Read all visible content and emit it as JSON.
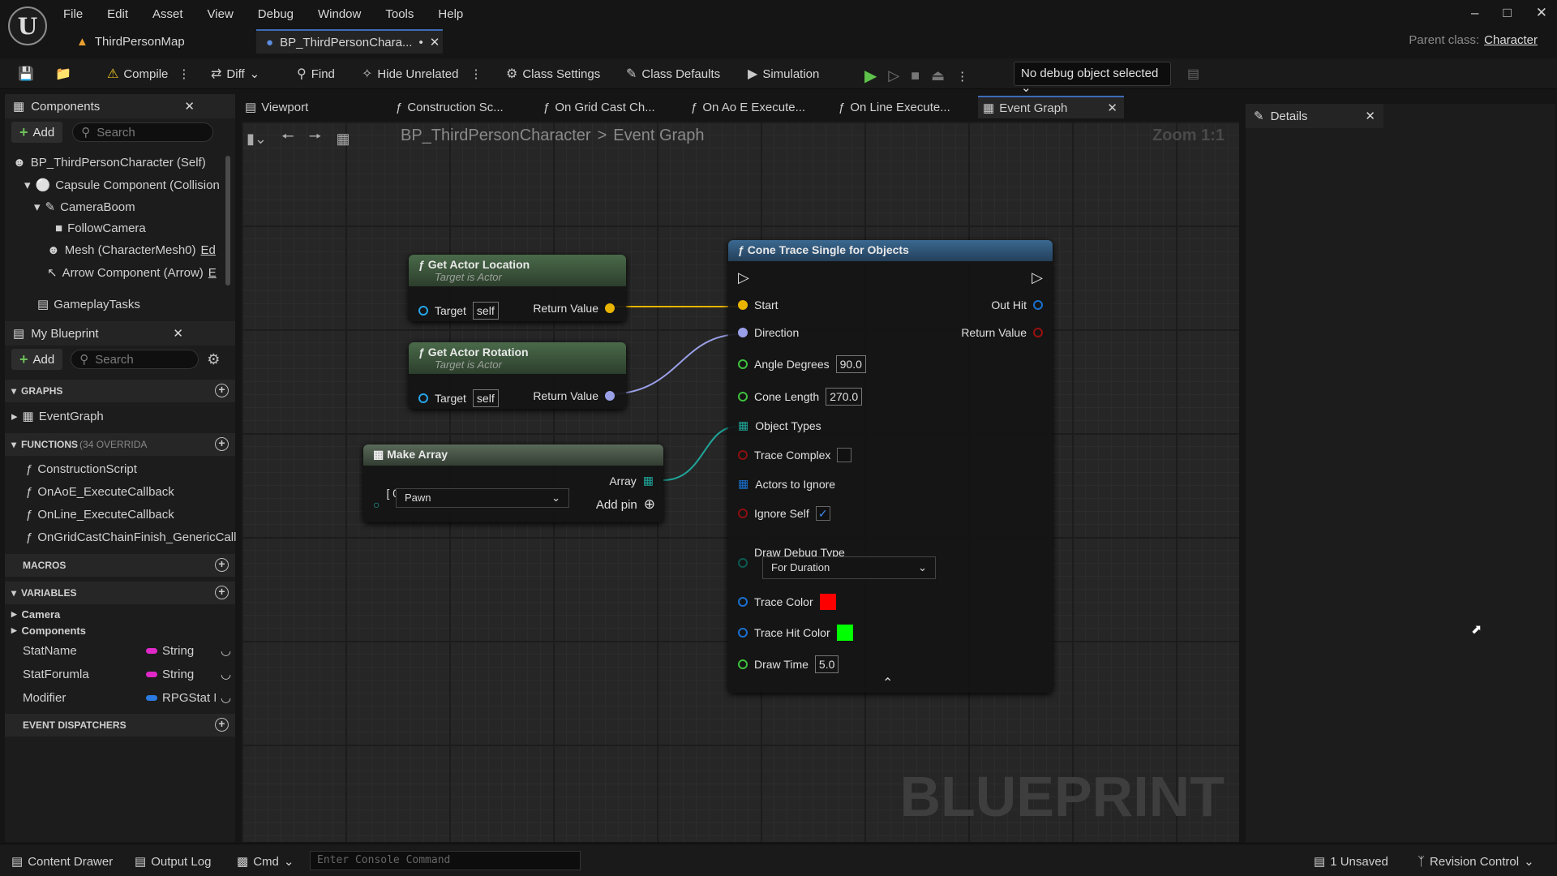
{
  "app": {
    "logo": "U"
  },
  "menu": [
    "File",
    "Edit",
    "Asset",
    "View",
    "Debug",
    "Window",
    "Tools",
    "Help"
  ],
  "window_controls": [
    "minimize-icon",
    "maximize-icon",
    "close-icon"
  ],
  "tabs": [
    {
      "label": "ThirdPersonMap",
      "icon": "map-icon"
    },
    {
      "label": "BP_ThirdPersonChara...",
      "icon": "blueprint-icon",
      "modified": "•"
    }
  ],
  "parent_class": {
    "label": "Parent class:",
    "value": "Character"
  },
  "toolbar": {
    "compile": "Compile",
    "diff": "Diff",
    "find": "Find",
    "hide_unrelated": "Hide Unrelated",
    "class_settings": "Class Settings",
    "class_defaults": "Class Defaults",
    "simulation": "Simulation",
    "debug_object": "No debug object selected"
  },
  "components_panel": {
    "title": "Components",
    "add": "Add",
    "search_placeholder": "Search",
    "items": [
      {
        "label": "BP_ThirdPersonCharacter (Self)"
      },
      {
        "label": "Capsule Component (Collision"
      },
      {
        "label": "CameraBoom"
      },
      {
        "label": "FollowCamera"
      },
      {
        "label": "Mesh (CharacterMesh0)",
        "extra": "Ed"
      },
      {
        "label": "Arrow Component (Arrow)",
        "extra": "E"
      },
      {
        "label": "GameplayTasks"
      }
    ]
  },
  "my_blueprint": {
    "title": "My Blueprint",
    "add": "Add",
    "search_placeholder": "Search",
    "graphs_header": "GRAPHS",
    "graphs": [
      "EventGraph"
    ],
    "functions_header": "FUNCTIONS",
    "functions_override": "(34 OVERRIDA",
    "functions": [
      "ConstructionScript",
      "OnAoE_ExecuteCallback",
      "OnLine_ExecuteCallback",
      "OnGridCastChainFinish_GenericCall"
    ],
    "macros_header": "MACROS",
    "variables_header": "VARIABLES",
    "var_categories": [
      "Camera",
      "Components"
    ],
    "variables": [
      {
        "name": "StatName",
        "type": "String",
        "color": "#e028c8"
      },
      {
        "name": "StatForumla",
        "type": "String",
        "color": "#e028c8"
      },
      {
        "name": "Modifier",
        "type": "RPGStat N",
        "color": "#2a7ae0"
      }
    ],
    "dispatchers_header": "EVENT DISPATCHERS"
  },
  "graph_tabs": [
    "Viewport",
    "Construction Sc...",
    "On Grid Cast Ch...",
    "On Ao E Execute...",
    "On Line Execute...",
    "Event Graph"
  ],
  "breadcrumb": {
    "root": "BP_ThirdPersonCharacter",
    "separator": ">",
    "current": "Event Graph"
  },
  "zoom": "Zoom 1:1",
  "watermark": "BLUEPRINT",
  "nodes": {
    "get_actor_location": {
      "title": "Get Actor Location",
      "subtitle": "Target is Actor",
      "target_label": "Target",
      "target_value": "self",
      "return_label": "Return Value"
    },
    "get_actor_rotation": {
      "title": "Get Actor Rotation",
      "subtitle": "Target is Actor",
      "target_label": "Target",
      "target_value": "self",
      "return_label": "Return Value"
    },
    "make_array": {
      "title": "Make Array",
      "index_label": "[ 0]",
      "dropdown_value": "Pawn",
      "array_label": "Array",
      "add_pin": "Add pin"
    },
    "cone_trace": {
      "title": "Cone Trace Single for Objects",
      "start": "Start",
      "direction": "Direction",
      "out_hit": "Out Hit",
      "return_value": "Return Value",
      "angle_label": "Angle Degrees",
      "angle_value": "90.0",
      "cone_length_label": "Cone Length",
      "cone_length_value": "270.0",
      "object_types": "Object Types",
      "trace_complex": "Trace Complex",
      "actors_to_ignore": "Actors to Ignore",
      "ignore_self": "Ignore Self",
      "draw_debug_type": "Draw Debug Type",
      "draw_debug_value": "For Duration",
      "trace_color_label": "Trace Color",
      "trace_color": "#ff0000",
      "trace_hit_color_label": "Trace Hit Color",
      "trace_hit_color": "#00ff00",
      "draw_time_label": "Draw Time",
      "draw_time_value": "5.0"
    }
  },
  "details": {
    "title": "Details"
  },
  "status": {
    "content_drawer": "Content Drawer",
    "output_log": "Output Log",
    "cmd": "Cmd",
    "console_placeholder": "Enter Console Command",
    "unsaved": "1 Unsaved",
    "revision": "Revision Control"
  }
}
